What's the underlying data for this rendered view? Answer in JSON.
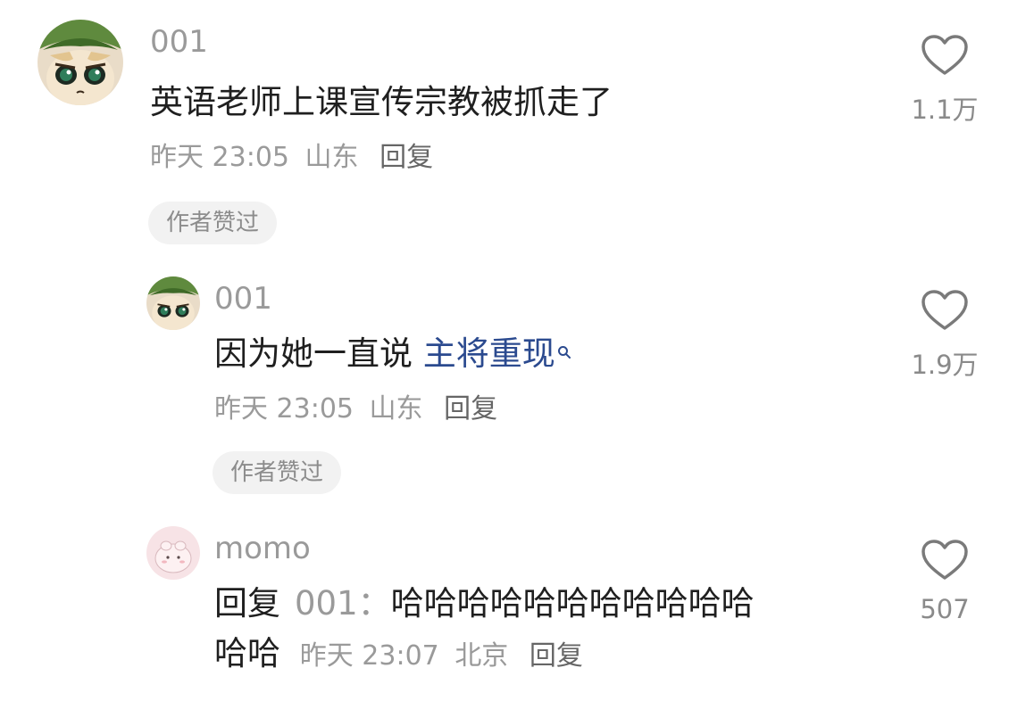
{
  "comments": [
    {
      "username": "001",
      "text": "英语老师上课宣传宗教被抓走了",
      "time": "昨天 23:05",
      "location": "山东",
      "reply_label": "回复",
      "badge": "作者赞过",
      "likes": "1.1万"
    },
    {
      "username": "001",
      "text_prefix": "因为她一直说 ",
      "link_text": "主将重现",
      "time": "昨天 23:05",
      "location": "山东",
      "reply_label": "回复",
      "badge": "作者赞过",
      "likes": "1.9万"
    },
    {
      "username": "momo",
      "reply_prefix": "回复",
      "reply_to": "001：",
      "text_line1": "哈哈哈哈哈哈哈哈哈哈哈",
      "text_line2": "哈哈",
      "time": "昨天 23:07",
      "location": "北京",
      "reply_label": "回复",
      "likes": "507"
    }
  ],
  "icons": {
    "like": "heart-outline-icon",
    "search": "search-icon"
  },
  "colors": {
    "text": "#1f1f1f",
    "muted": "#9a9a9a",
    "link": "#2b4a8f",
    "badge_bg": "#f2f2f2"
  }
}
